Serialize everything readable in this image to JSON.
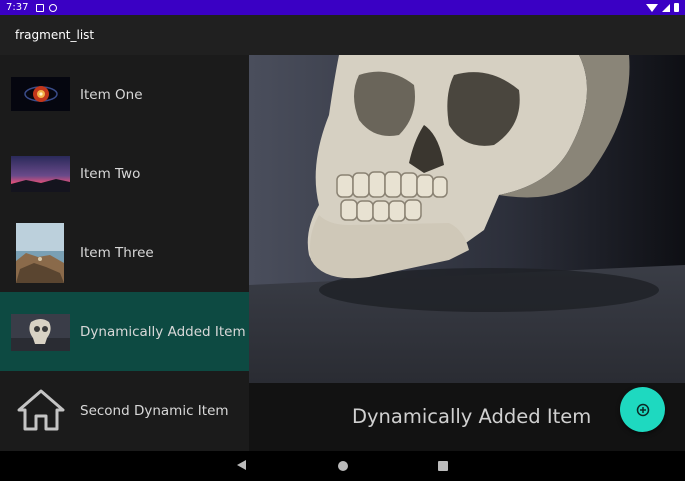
{
  "status_bar": {
    "time": "7:37"
  },
  "app_bar": {
    "title": "fragment_list"
  },
  "list": {
    "items": [
      {
        "label": "Item One",
        "thumbnail": "galaxy-image"
      },
      {
        "label": "Item Two",
        "thumbnail": "sunset-image"
      },
      {
        "label": "Item Three",
        "thumbnail": "coastline-image"
      },
      {
        "label": "Dynamically Added Item",
        "thumbnail": "skull-image",
        "selected": true
      },
      {
        "label": "Second Dynamic Item",
        "thumbnail": "home-icon"
      }
    ]
  },
  "detail": {
    "title": "Dynamically Added Item",
    "image": "skull-painting"
  },
  "fab": {
    "icon": "add-circle-icon"
  },
  "colors": {
    "status_bar": "#3a00c4",
    "selected_row": "#0d4a42",
    "fab": "#1ed9c0"
  }
}
